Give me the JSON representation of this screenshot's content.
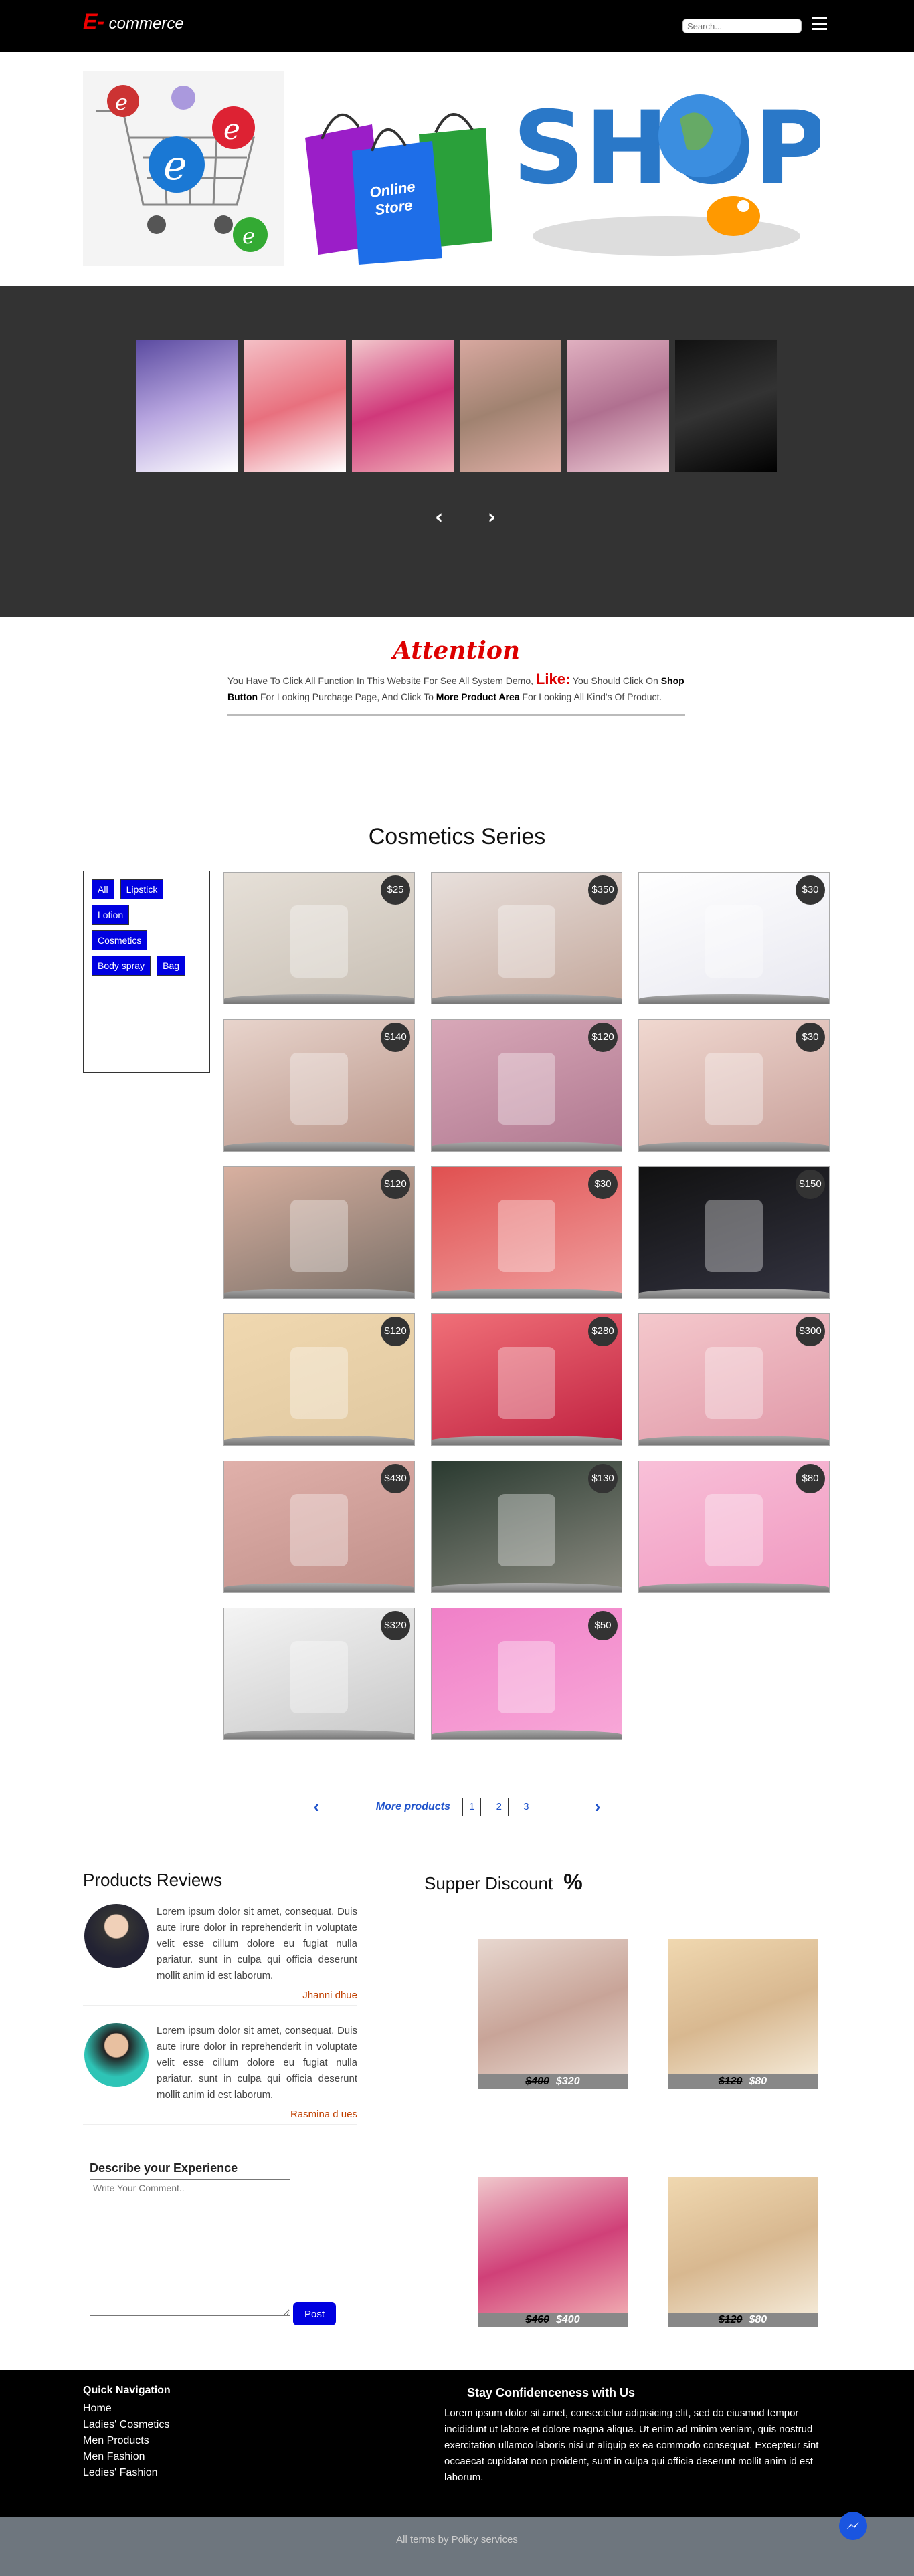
{
  "header": {
    "logo_e": "E-",
    "logo_text": "commerce",
    "search_placeholder": "Search..."
  },
  "attention": {
    "title": "Attention",
    "text_1": "You Have To Click All Function In This Website For See All System Demo,",
    "like": "Like:",
    "text_2": "You Should Click On",
    "shop_button": "Shop Button",
    "text_3": "For Looking Purchage Page, And Click To",
    "more_area": "More Product Area",
    "text_4": "For Looking All Kind's Of Product."
  },
  "series": {
    "title": "Cosmetics Series",
    "filters": [
      "All",
      "Lipstick",
      "Lotion",
      "Cosmetics",
      "Body spray",
      "Bag"
    ],
    "products": [
      {
        "price": "$25",
        "icon": "lipstick-image"
      },
      {
        "price": "$350",
        "icon": "handbag-image"
      },
      {
        "price": "$30",
        "icon": "lipstick-box-image"
      },
      {
        "price": "$140",
        "icon": "cosmetics-display-image"
      },
      {
        "price": "$120",
        "icon": "cosmetics-podium-image"
      },
      {
        "price": "$30",
        "icon": "cosmetics-steps-image"
      },
      {
        "price": "$120",
        "icon": "skincare-image"
      },
      {
        "price": "$30",
        "icon": "red-cosmetics-image"
      },
      {
        "price": "$150",
        "icon": "body-spray-image"
      },
      {
        "price": "$120",
        "icon": "serum-bottle-image"
      },
      {
        "price": "$280",
        "icon": "red-bag-image"
      },
      {
        "price": "$300",
        "icon": "lotion-bottle-image"
      },
      {
        "price": "$430",
        "icon": "beige-bag-image"
      },
      {
        "price": "$130",
        "icon": "dark-lotion-image"
      },
      {
        "price": "$80",
        "icon": "pink-tube-image"
      },
      {
        "price": "$320",
        "icon": "white-products-image"
      },
      {
        "price": "$50",
        "icon": "perfume-set-image"
      }
    ]
  },
  "pagination": {
    "prev": "‹",
    "more": "More products",
    "pages": [
      "1",
      "2",
      "3"
    ],
    "next": "›"
  },
  "reviews": {
    "title": "Products Reviews",
    "items": [
      {
        "text": "Lorem ipsum dolor sit amet, consequat. Duis aute irure dolor in reprehenderit in voluptate velit esse cillum dolore eu fugiat nulla pariatur. sunt in culpa qui officia deserunt mollit anim id est laborum.",
        "author": "Jhanni dhue"
      },
      {
        "text": "Lorem ipsum dolor sit amet, consequat. Duis aute irure dolor in reprehenderit in voluptate velit esse cillum dolore eu fugiat nulla pariatur. sunt in culpa qui officia deserunt mollit anim id est laborum.",
        "author": "Rasmina d ues"
      }
    ],
    "comment_label": "Describe your Experience",
    "comment_placeholder": "Write Your Comment..",
    "post_label": "Post"
  },
  "discount": {
    "title": "Supper Discount",
    "pct_icon": "%",
    "items": [
      {
        "old": "$400",
        "new": "$320"
      },
      {
        "old": "$120",
        "new": "$80"
      },
      {
        "old": "$460",
        "new": "$400"
      },
      {
        "old": "$120",
        "new": "$80"
      }
    ]
  },
  "footer": {
    "nav_title": "Quick Navigation",
    "nav": [
      "Home",
      "Ladies' Cosmetics",
      "Men Products",
      "Men Fashion",
      "Ledies' Fashion"
    ],
    "stay_title": "Stay Confidenceness with Us",
    "stay_text": "Lorem ipsum dolor sit amet, consectetur adipisicing elit, sed do eiusmod tempor incididunt ut labore et dolore magna aliqua. Ut enim ad minim veniam, quis nostrud exercitation ullamco laboris nisi ut aliquip ex ea commodo consequat. Excepteur sint occaecat cupidatat non proident, sunt in culpa qui officia deserunt mollit anim id est laborum.",
    "bottom": "All terms by Policy services"
  },
  "banner": {
    "online": "Online",
    "store": "Store",
    "shop": "SHOP"
  },
  "slider": {
    "arrows": "‹ ›"
  }
}
